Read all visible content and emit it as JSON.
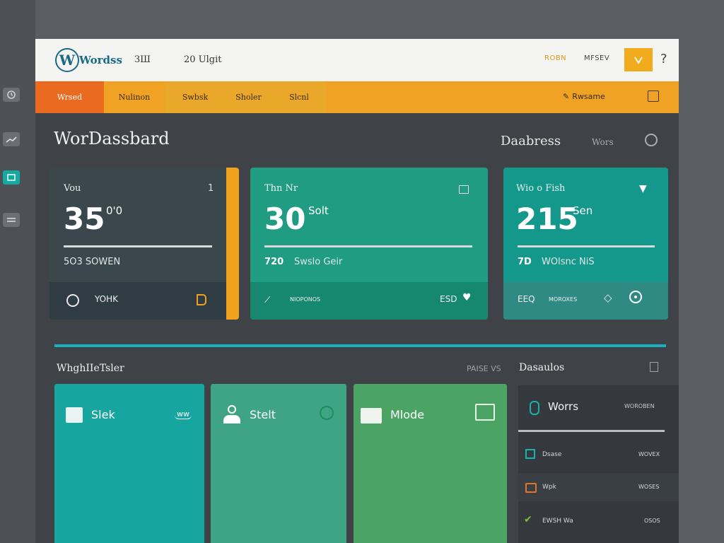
{
  "colors": {
    "accent_orange": "#efa223",
    "accent_active": "#ea6a1f",
    "teal": "#16b0be",
    "card_dark": "#35444a",
    "card_teal": "#1f9c82",
    "card_teal2": "#15988c"
  },
  "topbar": {
    "brand": "Wordss",
    "item1": "ЗШ",
    "item2": "20 Ulgit",
    "right1": "ROBN",
    "right2": "MFSEV",
    "help_icon": "question-icon"
  },
  "nav": {
    "items": [
      "Wrsed",
      "Nulinon",
      "Swbsk",
      "Sholer",
      "Slcnl"
    ],
    "right_label": "Rwsame"
  },
  "page": {
    "title": "WorDassbard",
    "right_title": "Daabress",
    "right_link": "Wors"
  },
  "stats": [
    {
      "label": "Vou",
      "value": "35",
      "unit": "0'0",
      "sub": "5O3 SOWEN",
      "footer_text": "YOHK",
      "corner": "1"
    },
    {
      "label": "Thn Nr",
      "value": "30",
      "unit": "Solt",
      "sub_num": "720",
      "sub": "Swslo Geir",
      "footer_text": "NIOPONOS",
      "footer_right": "ESD"
    },
    {
      "label": "Wio o Fish",
      "value": "215",
      "unit": "Sen",
      "sub_num": "7D",
      "sub": "WOlsnc NiS",
      "footer_left": "EEQ",
      "footer_text": "MOROXES"
    }
  ],
  "section": {
    "title": "WhghIIeTsler",
    "mid": "PAISE VS",
    "right_title": "Dasaulos"
  },
  "tiles": [
    {
      "label": "Slek",
      "badge": "ww"
    },
    {
      "label": "Stelt"
    },
    {
      "label": "Mlode"
    }
  ],
  "side_panel": {
    "title": "Worrs",
    "title_right": "WOROBEN",
    "rows": [
      {
        "label": "Dsase",
        "value": "WOVEX"
      },
      {
        "label": "Wpk",
        "value": "WOSES"
      },
      {
        "label": "EWSH Wa",
        "value": "OSOS"
      }
    ]
  }
}
